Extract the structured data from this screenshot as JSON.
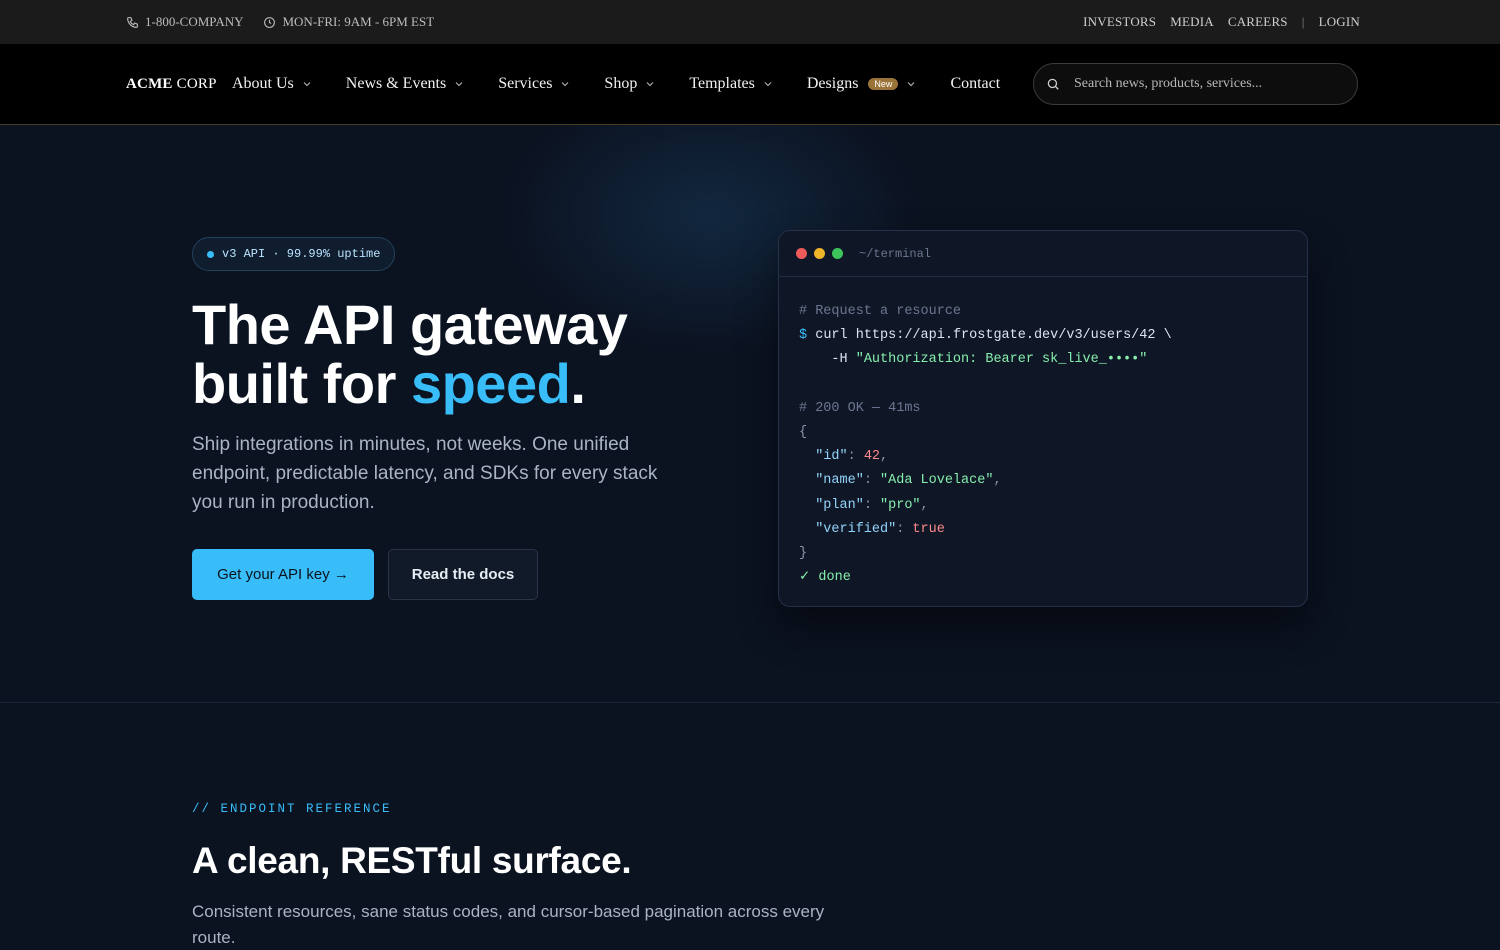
{
  "topbar": {
    "phone": "1-800-COMPANY",
    "hours": "MON-FRI: 9AM - 6PM EST",
    "links": [
      "INVESTORS",
      "MEDIA",
      "CAREERS"
    ],
    "separator": "|",
    "login": "LOGIN"
  },
  "nav": {
    "logo_bold": "ACME",
    "logo_rest": "CORP",
    "items": [
      {
        "label": "About Us"
      },
      {
        "label": "News & Events"
      },
      {
        "label": "Services"
      },
      {
        "label": "Shop"
      },
      {
        "label": "Templates"
      },
      {
        "label": "Designs",
        "badge": "New"
      },
      {
        "label": "Contact"
      }
    ],
    "search_placeholder": "Search news, products, services..."
  },
  "hero": {
    "pill": "v3 API · 99.99% uptime",
    "title_line1": "The API gateway",
    "title_line2_pre": "built for ",
    "title_accent": "speed",
    "title_end": ".",
    "lede": "Ship integrations in minutes, not weeks. One unified endpoint, predictable latency, and SDKs for every stack you run in production.",
    "cta_primary": "Get your API key →",
    "cta_secondary": "Read the docs"
  },
  "terminal": {
    "title": "~/terminal",
    "comment1": "# Request a resource",
    "prompt": "$",
    "cmd": "curl https://api.frostgate.dev/v3/users/42 \\",
    "header_flag": "-H",
    "header_value": "\"Authorization: Bearer sk_live_••••\"",
    "comment2": "# 200 OK — 41ms",
    "open_brace": "{",
    "fields": [
      {
        "key": "\"id\"",
        "value": "42",
        "type": "num"
      },
      {
        "key": "\"name\"",
        "value": "\"Ada Lovelace\"",
        "type": "str"
      },
      {
        "key": "\"plan\"",
        "value": "\"pro\"",
        "type": "str"
      },
      {
        "key": "\"verified\"",
        "value": "true",
        "type": "bool"
      }
    ],
    "close_brace": "}",
    "done": "✓ done"
  },
  "section2": {
    "eyebrow": "// ENDPOINT REFERENCE",
    "title": "A clean, RESTful surface.",
    "lede": "Consistent resources, sane status codes, and cursor-based pagination across every route."
  },
  "colors": {
    "accent": "#38bdf8",
    "background": "#0b1220",
    "badge": "#9a7338"
  }
}
